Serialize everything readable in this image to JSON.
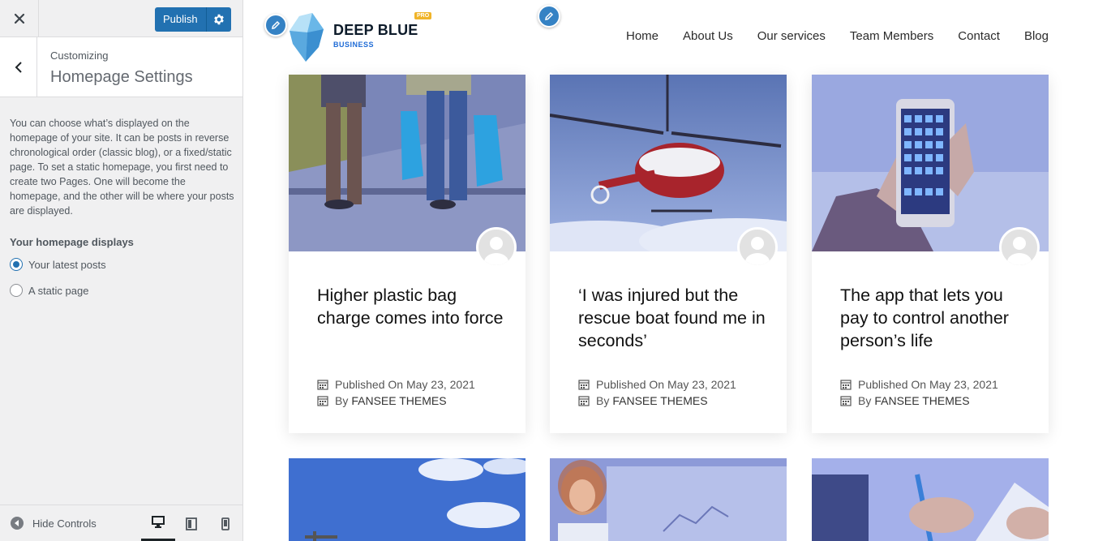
{
  "sidebar": {
    "close_icon": "close-icon",
    "publish_label": "Publish",
    "customizing_label": "Customizing",
    "section_title": "Homepage Settings",
    "description": "You can choose what’s displayed on the homepage of your site. It can be posts in reverse chronological order (classic blog), or a fixed/static page. To set a static homepage, you first need to create two Pages. One will become the homepage, and the other will be where your posts are displayed.",
    "homepage_displays_label": "Your homepage displays",
    "options": [
      {
        "label": "Your latest posts",
        "checked": true
      },
      {
        "label": "A static page",
        "checked": false
      }
    ],
    "hide_controls_label": "Hide Controls",
    "accent_color": "#2271b1"
  },
  "site": {
    "brand_name": "DEEP BLUE",
    "brand_badge": "PRO",
    "brand_sub": "BUSINESS",
    "nav": [
      "Home",
      "About Us",
      "Our services",
      "Team Members",
      "Contact",
      "Blog"
    ]
  },
  "posts": [
    {
      "title": "Higher plastic bag charge comes into force",
      "published": "Published On",
      "date": "May 23, 2021",
      "by": "By",
      "author": "FANSEE THEMES"
    },
    {
      "title": "‘I was injured but the rescue boat found me in seconds’",
      "published": "Published On",
      "date": "May 23, 2021",
      "by": "By",
      "author": "FANSEE THEMES"
    },
    {
      "title": "The app that lets you pay to control another person’s life",
      "published": "Published On",
      "date": "May 23, 2021",
      "by": "By",
      "author": "FANSEE THEMES"
    }
  ]
}
